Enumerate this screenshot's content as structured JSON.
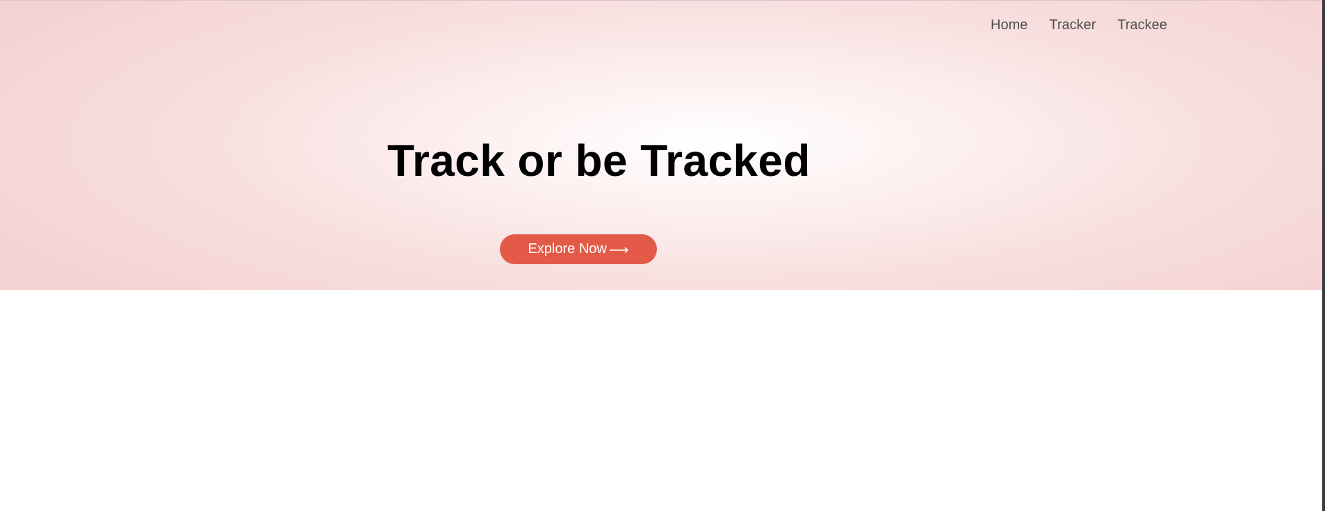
{
  "nav": {
    "items": [
      {
        "label": "Home"
      },
      {
        "label": "Tracker"
      },
      {
        "label": "Trackee"
      }
    ]
  },
  "hero": {
    "title": "Track or be Tracked",
    "cta_label": "Explore Now",
    "cta_icon": "arrow-right-icon",
    "cta_arrow": "⟶"
  },
  "colors": {
    "accent": "#e35b48",
    "hero_bg_edge": "#f5d2d2",
    "nav_text": "#4f4f4f"
  }
}
